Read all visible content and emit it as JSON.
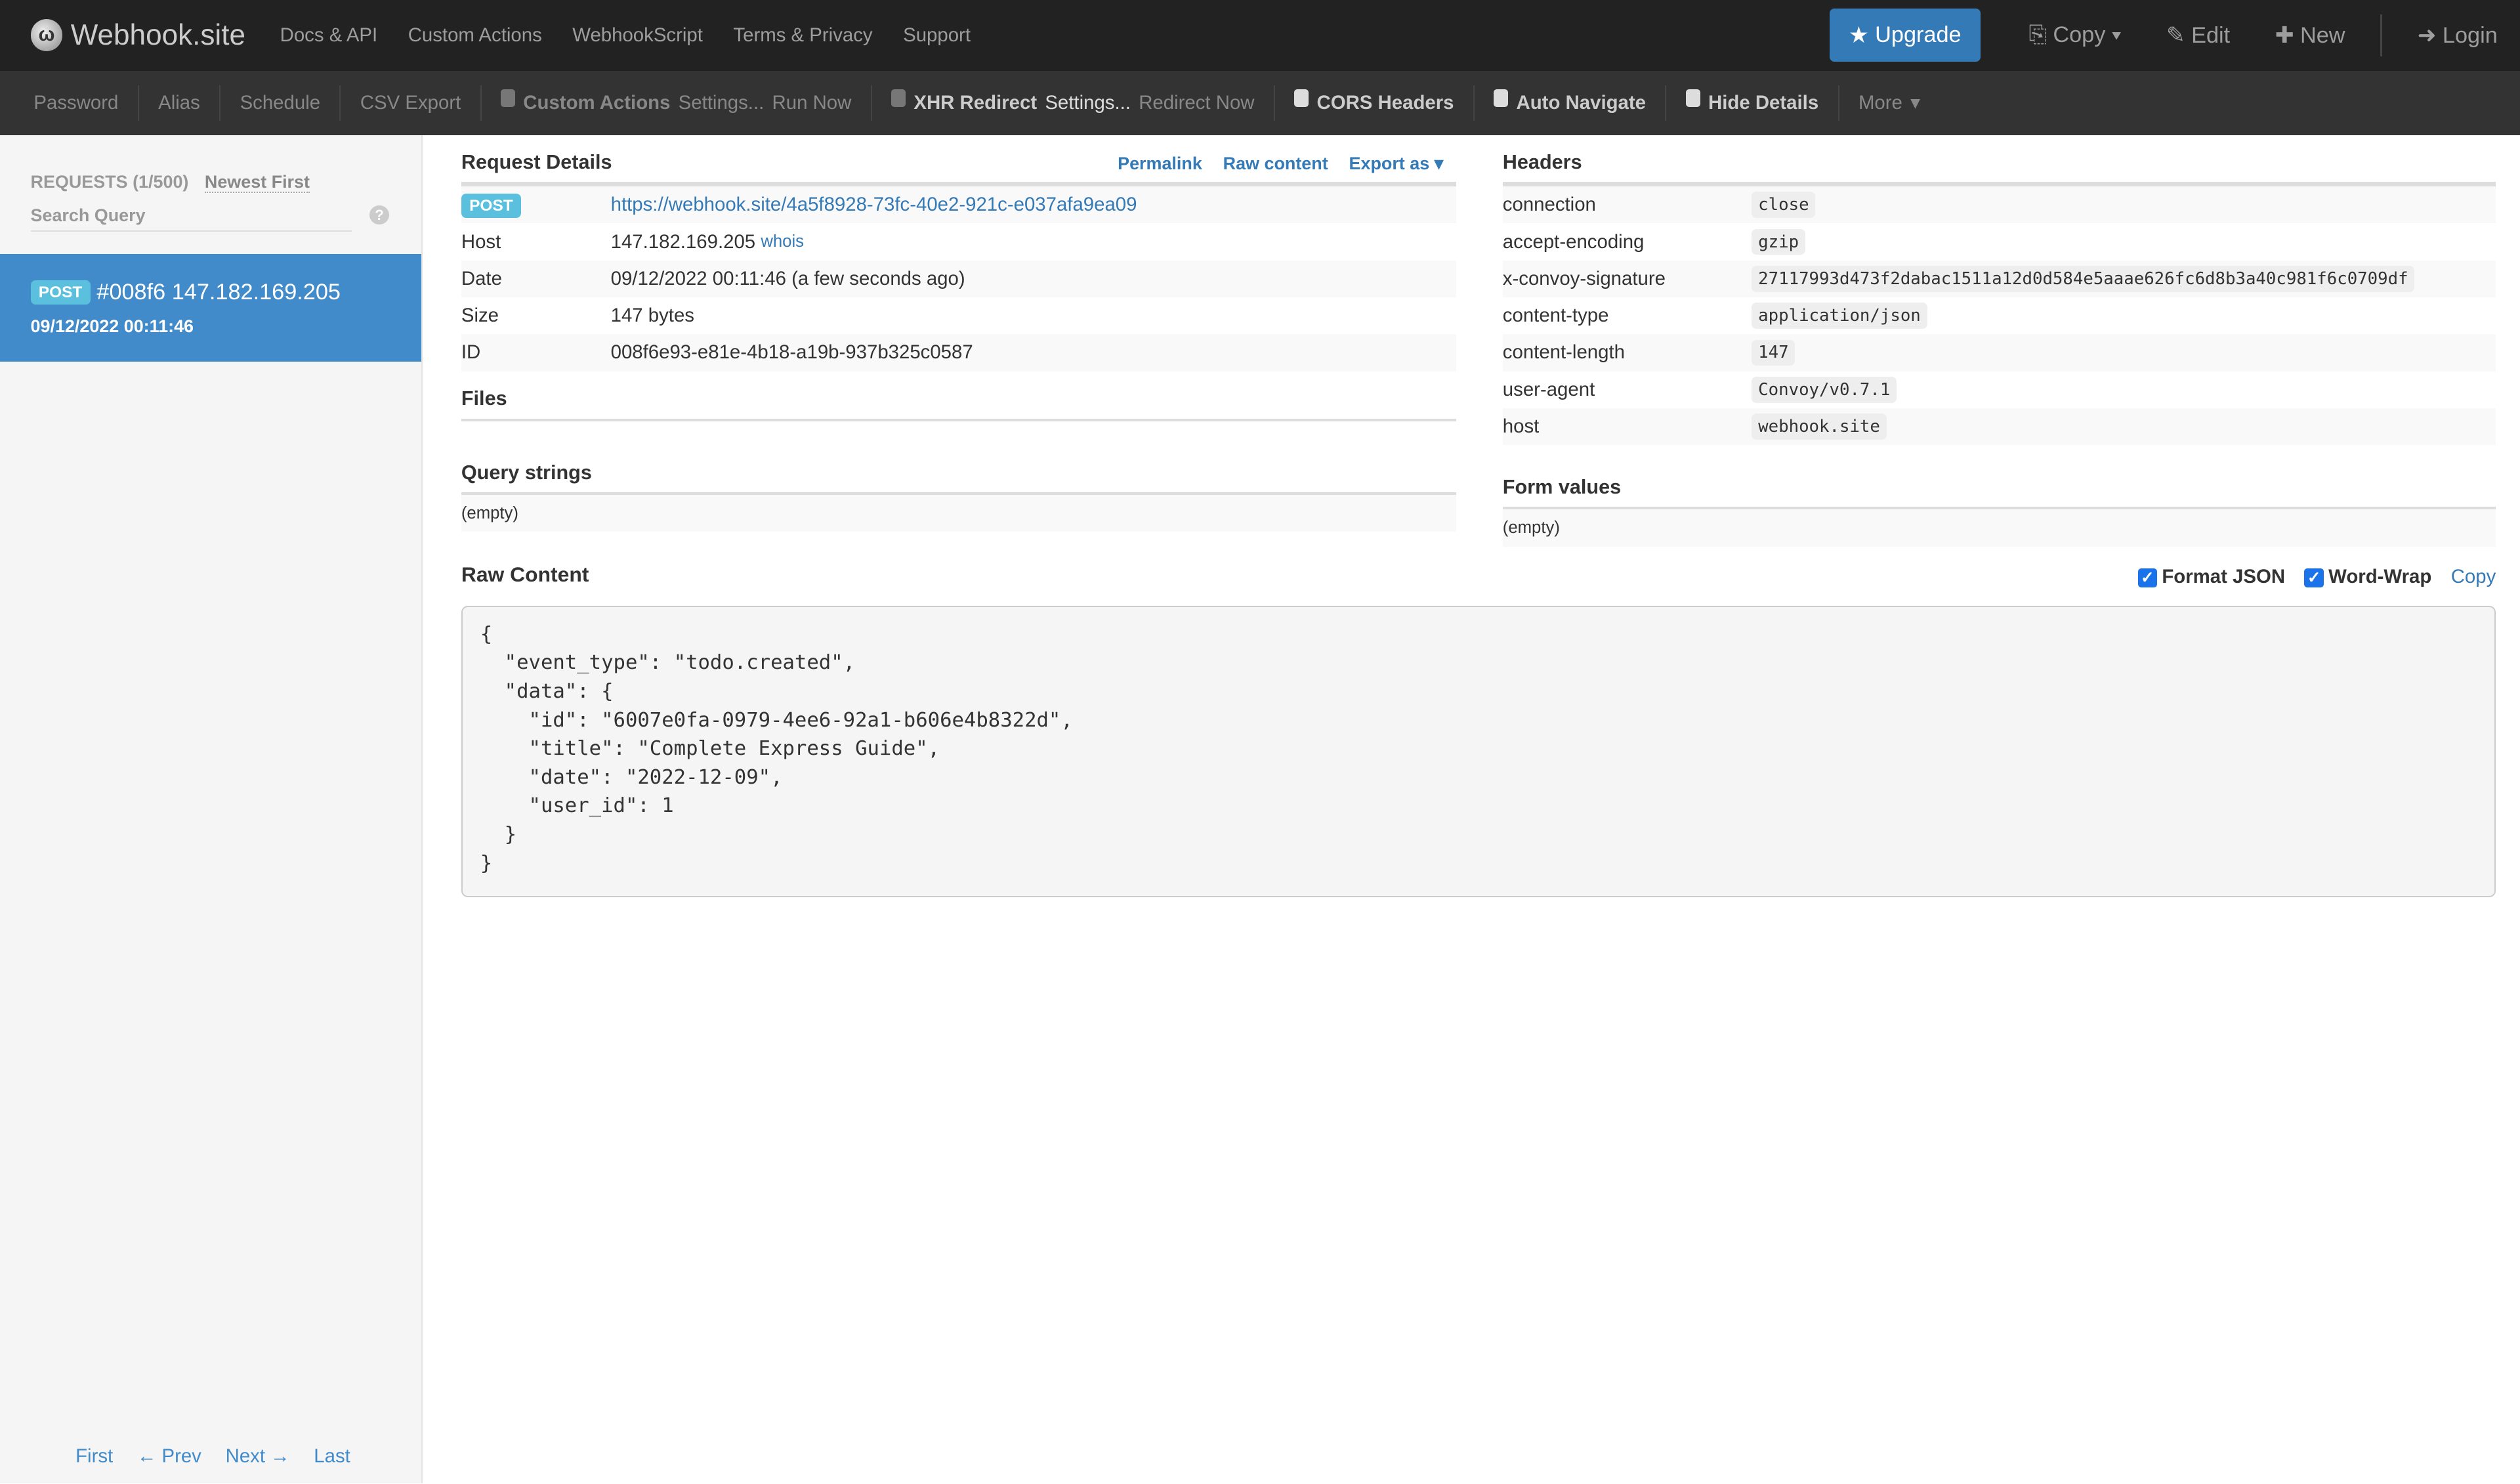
{
  "topbar": {
    "brand": "Webhook.site",
    "nav": [
      "Docs & API",
      "Custom Actions",
      "WebhookScript",
      "Terms & Privacy",
      "Support"
    ],
    "upgrade": "Upgrade",
    "copy": "Copy",
    "edit": "Edit",
    "new": "New",
    "login": "Login"
  },
  "toolbar": {
    "password": "Password",
    "alias": "Alias",
    "schedule": "Schedule",
    "csv_export": "CSV Export",
    "custom_actions": "Custom Actions",
    "ca_settings": "Settings...",
    "run_now": "Run Now",
    "xhr_redirect": "XHR Redirect",
    "xhr_settings": "Settings...",
    "redirect_now": "Redirect Now",
    "cors": "CORS Headers",
    "auto_navigate": "Auto Navigate",
    "hide_details": "Hide Details",
    "more": "More"
  },
  "sidebar": {
    "requests_label": "REQUESTS (1/500)",
    "sort": "Newest First",
    "search_placeholder": "Search Query",
    "help": "?",
    "request": {
      "method": "POST",
      "title": "#008f6 147.182.169.205",
      "time": "09/12/2022 00:11:46"
    },
    "pager": [
      "First",
      "← Prev",
      "Next →",
      "Last"
    ]
  },
  "details": {
    "title": "Request Details",
    "permalink": "Permalink",
    "raw_content": "Raw content",
    "export_as": "Export as",
    "method": "POST",
    "url": "https://webhook.site/4a5f8928-73fc-40e2-921c-e037afa9ea09",
    "rows": [
      {
        "k": "Host",
        "v": "147.182.169.205",
        "link": "whois"
      },
      {
        "k": "Date",
        "v": "09/12/2022 00:11:46 (a few seconds ago)"
      },
      {
        "k": "Size",
        "v": "147 bytes"
      },
      {
        "k": "ID",
        "v": "008f6e93-e81e-4b18-a19b-937b325c0587"
      }
    ],
    "files": "Files",
    "query_strings": "Query strings",
    "query_empty": "(empty)"
  },
  "headers": {
    "title": "Headers",
    "rows": [
      {
        "k": "connection",
        "v": "close"
      },
      {
        "k": "accept-encoding",
        "v": "gzip"
      },
      {
        "k": "x-convoy-signature",
        "v": "27117993d473f2dabac1511a12d0d584e5aaae626fc6d8b3a40c981f6c0709df"
      },
      {
        "k": "content-type",
        "v": "application/json"
      },
      {
        "k": "content-length",
        "v": "147"
      },
      {
        "k": "user-agent",
        "v": "Convoy/v0.7.1"
      },
      {
        "k": "host",
        "v": "webhook.site"
      }
    ],
    "form_values": "Form values",
    "form_empty": "(empty)"
  },
  "raw": {
    "title": "Raw Content",
    "format_json": "Format JSON",
    "word_wrap": "Word-Wrap",
    "copy": "Copy",
    "body": "{\n  \"event_type\": \"todo.created\",\n  \"data\": {\n    \"id\": \"6007e0fa-0979-4ee6-92a1-b606e4b8322d\",\n    \"title\": \"Complete Express Guide\",\n    \"date\": \"2022-12-09\",\n    \"user_id\": 1\n  }\n}"
  }
}
